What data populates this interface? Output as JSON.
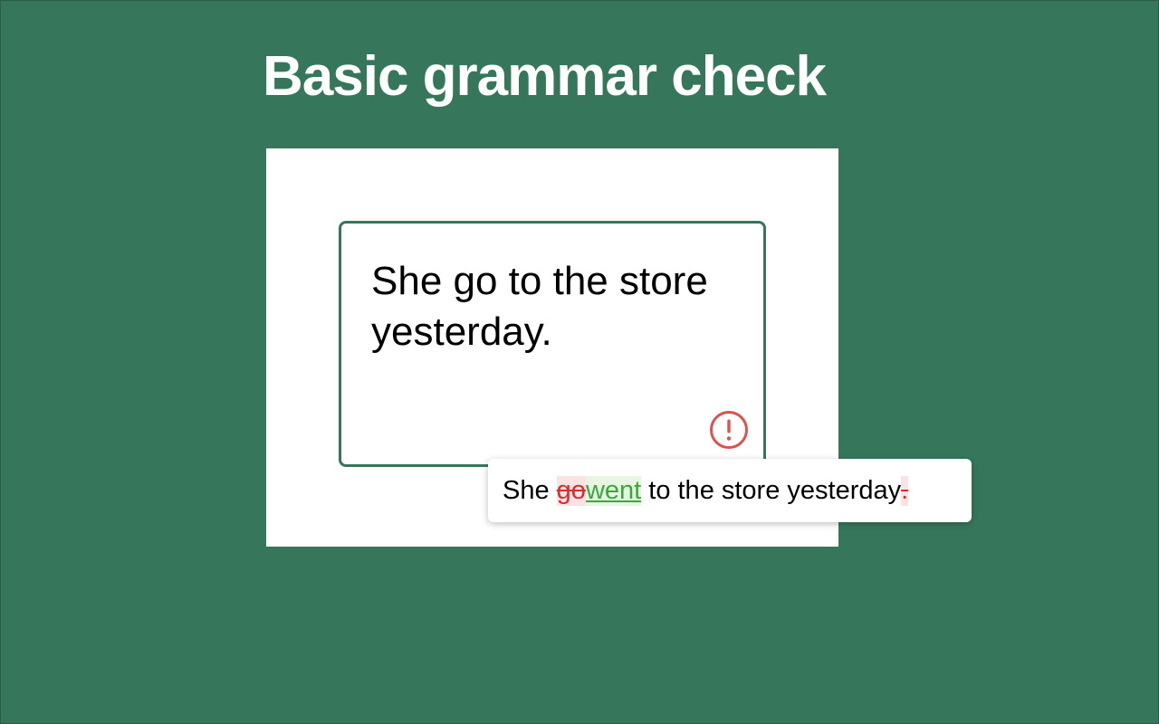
{
  "page": {
    "title": "Basic grammar check"
  },
  "editor": {
    "text": "She go to the store yesterday.",
    "alert_icon": "exclamation-circle-icon"
  },
  "suggestion": {
    "prefix": "She ",
    "deleted_word": "go",
    "inserted_word": "went",
    "middle": " to the store yesterday",
    "deleted_punct": "."
  },
  "colors": {
    "background": "#36775c",
    "editor_border": "#36775c",
    "alert": "#d9534f",
    "deletion": "#d32f2f",
    "insertion": "#3aa83a"
  }
}
